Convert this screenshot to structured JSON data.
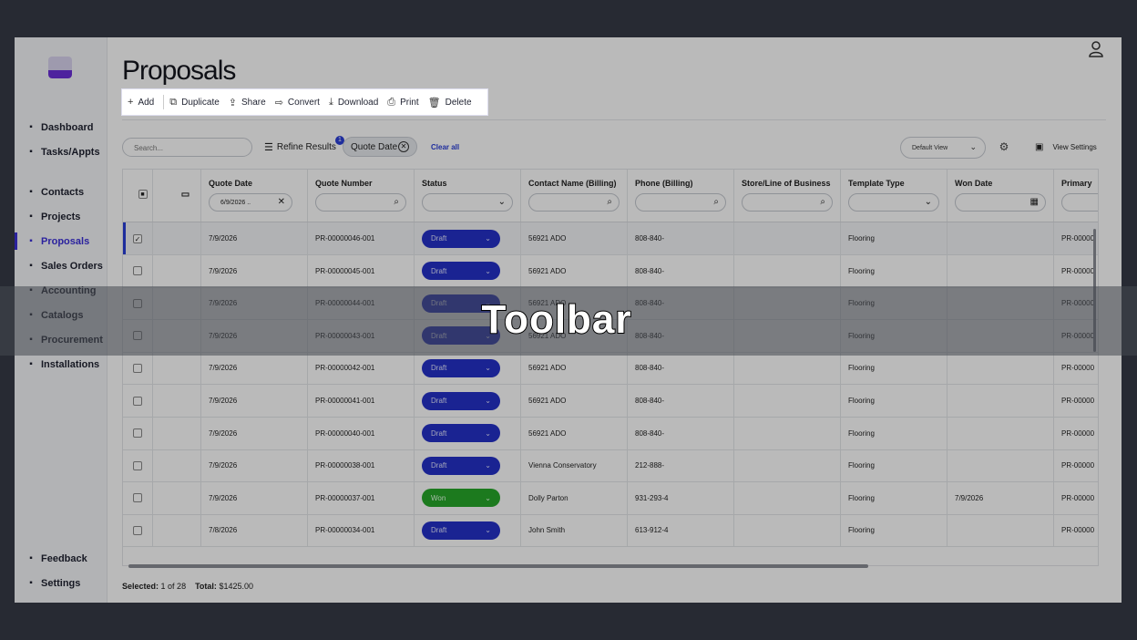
{
  "page": {
    "title": "Proposals"
  },
  "sidebar": {
    "items_top": [
      {
        "label": "Dashboard",
        "icon": "dashboard-icon"
      },
      {
        "label": "Tasks/Appts",
        "icon": "tasks-icon"
      }
    ],
    "items_main": [
      {
        "label": "Contacts",
        "icon": "contacts-icon"
      },
      {
        "label": "Projects",
        "icon": "projects-icon"
      },
      {
        "label": "Proposals",
        "icon": "proposals-icon",
        "active": true
      },
      {
        "label": "Sales Orders",
        "icon": "sales-orders-icon"
      },
      {
        "label": "Accounting",
        "icon": "accounting-icon"
      },
      {
        "label": "Catalogs",
        "icon": "catalogs-icon"
      },
      {
        "label": "Procurement",
        "icon": "procurement-icon"
      },
      {
        "label": "Installations",
        "icon": "installations-icon"
      }
    ],
    "items_bottom": [
      {
        "label": "Feedback",
        "icon": "feedback-icon"
      },
      {
        "label": "Settings",
        "icon": "settings-icon"
      }
    ]
  },
  "toolbar": {
    "add": "Add",
    "duplicate": "Duplicate",
    "share": "Share",
    "convert": "Convert",
    "download": "Download",
    "print": "Print",
    "delete": "Delete"
  },
  "filters": {
    "search_placeholder": "Search...",
    "refine_label": "Refine Results",
    "refine_count": "1",
    "chip_label": "Quote Date",
    "clear_all": "Clear all",
    "view_value": "Default View",
    "view_settings": "View Settings"
  },
  "grid": {
    "columns": [
      "Quote Date",
      "Quote Number",
      "Status",
      "Contact Name (Billing)",
      "Phone (Billing)",
      "Store/Line of Business",
      "Template Type",
      "Won Date",
      "Primary"
    ],
    "quote_date_filter": "6/9/2026 ..",
    "rows": [
      {
        "date": "7/9/2026",
        "number": "PR-00000046-001",
        "status": "Draft",
        "contact": "56921 ADO",
        "phone": "808-840-",
        "template": "Flooring",
        "won": "",
        "primary": "PR-00000",
        "checked": true
      },
      {
        "date": "7/9/2026",
        "number": "PR-00000045-001",
        "status": "Draft",
        "contact": "56921 ADO",
        "phone": "808-840-",
        "template": "Flooring",
        "won": "",
        "primary": "PR-00000"
      },
      {
        "date": "7/9/2026",
        "number": "PR-00000044-001",
        "status": "Draft",
        "contact": "56921 ADO",
        "phone": "808-840-",
        "template": "Flooring",
        "won": "",
        "primary": "PR-00000"
      },
      {
        "date": "7/9/2026",
        "number": "PR-00000043-001",
        "status": "Draft",
        "contact": "56921 ADO",
        "phone": "808-840-",
        "template": "Flooring",
        "won": "",
        "primary": "PR-00000"
      },
      {
        "date": "7/9/2026",
        "number": "PR-00000042-001",
        "status": "Draft",
        "contact": "56921 ADO",
        "phone": "808-840-",
        "template": "Flooring",
        "won": "",
        "primary": "PR-00000"
      },
      {
        "date": "7/9/2026",
        "number": "PR-00000041-001",
        "status": "Draft",
        "contact": "56921 ADO",
        "phone": "808-840-",
        "template": "Flooring",
        "won": "",
        "primary": "PR-00000"
      },
      {
        "date": "7/9/2026",
        "number": "PR-00000040-001",
        "status": "Draft",
        "contact": "56921 ADO",
        "phone": "808-840-",
        "template": "Flooring",
        "won": "",
        "primary": "PR-00000"
      },
      {
        "date": "7/9/2026",
        "number": "PR-00000038-001",
        "status": "Draft",
        "contact": "Vienna Conservatory",
        "phone": "212-888-",
        "template": "Flooring",
        "won": "",
        "primary": "PR-00000"
      },
      {
        "date": "7/9/2026",
        "number": "PR-00000037-001",
        "status": "Won",
        "contact": "Dolly Parton",
        "phone": "931-293-4",
        "template": "Flooring",
        "won": "7/9/2026",
        "primary": "PR-00000"
      },
      {
        "date": "7/8/2026",
        "number": "PR-00000034-001",
        "status": "Draft",
        "contact": "John Smith",
        "phone": "613-912-4",
        "template": "Flooring",
        "won": "",
        "primary": "PR-00000"
      }
    ]
  },
  "footer": {
    "selected_label": "Selected:",
    "selected_value": "1 of 28",
    "total_label": "Total:",
    "total_value": "$1425.00"
  },
  "overlay": {
    "caption": "Toolbar"
  }
}
